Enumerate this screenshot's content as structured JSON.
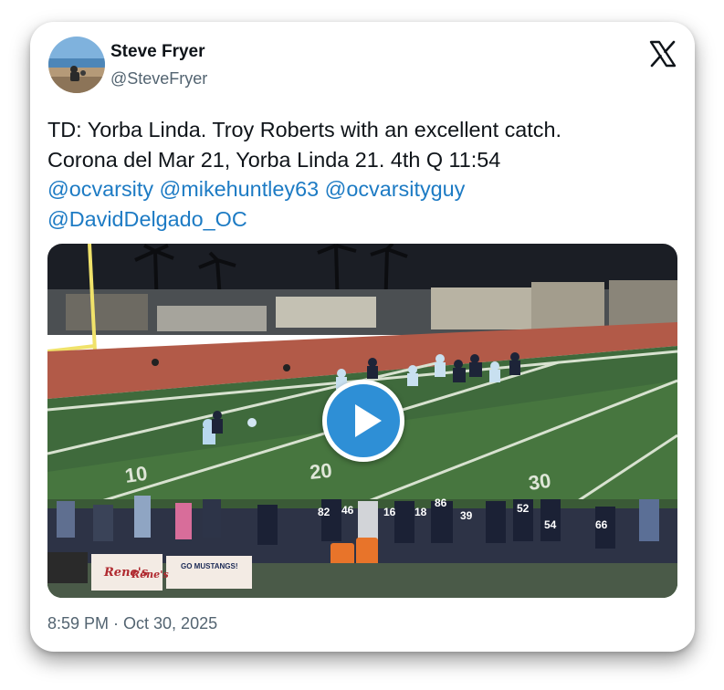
{
  "author": {
    "name": "Steve Fryer",
    "handle": "@SteveFryer"
  },
  "platform_icon": "x-logo",
  "tweet": {
    "text_line_1": "TD: Yorba Linda. Troy Roberts with an excellent catch.",
    "text_line_2": "Corona del Mar 21, Yorba Linda 21. 4th Q 11:54",
    "mentions": [
      "@ocvarsity",
      "@mikehuntley63",
      "@ocvarsityguy",
      "@DavidDelgado_OC"
    ]
  },
  "media": {
    "type": "video",
    "field_numbers": [
      "10",
      "20",
      "30"
    ],
    "jersey_numbers": [
      "82",
      "46",
      "16",
      "18",
      "86",
      "39",
      "52",
      "54",
      "66"
    ],
    "banners": [
      "Rene's",
      "Rene's",
      "GO MUSTANGS!"
    ],
    "play_icon": "play-icon"
  },
  "timestamp": "8:59 PM · Oct 30, 2025",
  "colors": {
    "mention": "#1d7bc4",
    "play_button": "#2e8fd6",
    "text": "#0f1419",
    "muted": "#536471"
  }
}
